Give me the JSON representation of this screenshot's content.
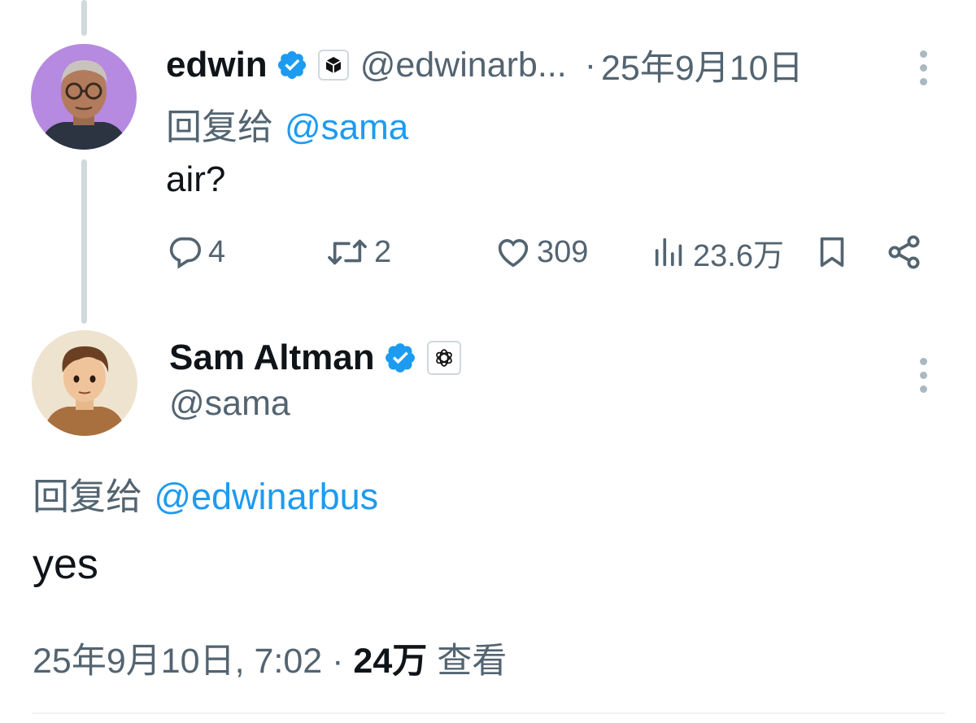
{
  "reply_tweet": {
    "author_name": "edwin",
    "handle": "@edwinarb...",
    "separator": "·",
    "date": "25年9月10日",
    "replying_prefix": "回复给",
    "replying_to": "@sama",
    "text": "air?",
    "actions": {
      "replies": "4",
      "retweets": "2",
      "likes": "309",
      "views": "23.6万"
    },
    "avatar_bg": "#b58ae0"
  },
  "main_tweet": {
    "author_name": "Sam Altman",
    "handle": "@sama",
    "replying_prefix": "回复给",
    "replying_to": "@edwinarbus",
    "text": "yes",
    "timestamp": "25年9月10日, 7:02",
    "separator": "·",
    "views_count": "24万",
    "views_label": "查看"
  },
  "icons": {
    "verified": "verified-badge-icon",
    "affiliation_edwin": "cube-logo-icon",
    "affiliation_sama": "openai-logo-icon",
    "more": "more-vertical-icon",
    "reply": "reply-icon",
    "retweet": "retweet-icon",
    "like": "heart-icon",
    "views": "views-icon",
    "bookmark": "bookmark-icon",
    "share": "share-icon"
  },
  "colors": {
    "verified": "#1d9bf0",
    "mention": "#1d9bf0",
    "secondary_text": "#536471",
    "primary_text": "#0f1419",
    "thread_line": "#cfd9de"
  }
}
